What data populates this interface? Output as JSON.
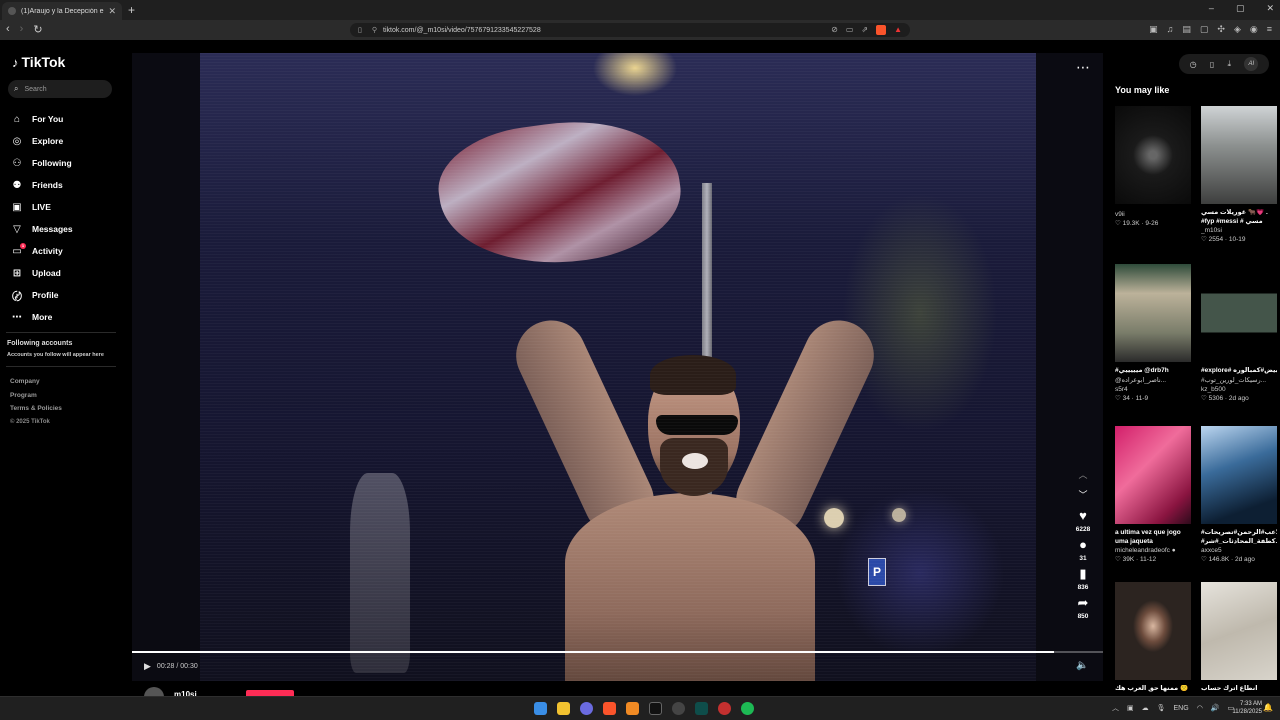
{
  "browser": {
    "tab_title": "(1)Araujo y la Decepción en la C...",
    "url": "tiktok.com/@_m10si/video/7576791233545227528",
    "new_tab": "+",
    "win_min": "–",
    "win_max": "▢",
    "win_close": "✕"
  },
  "sidebar": {
    "logo_text": "TikTok",
    "search_placeholder": "Search",
    "items": [
      {
        "label": "For You",
        "icon": "home-icon",
        "glyph": "⌂"
      },
      {
        "label": "Explore",
        "icon": "compass-icon",
        "glyph": "◎"
      },
      {
        "label": "Following",
        "icon": "following-icon",
        "glyph": "⚇"
      },
      {
        "label": "Friends",
        "icon": "friends-icon",
        "glyph": "⚉"
      },
      {
        "label": "LIVE",
        "icon": "live-icon",
        "glyph": "▣"
      },
      {
        "label": "Messages",
        "icon": "messages-icon",
        "glyph": "▽"
      },
      {
        "label": "Activity",
        "icon": "activity-icon",
        "glyph": "▭",
        "badge": "1"
      },
      {
        "label": "Upload",
        "icon": "upload-icon",
        "glyph": "⊞"
      },
      {
        "label": "Profile",
        "icon": "profile-icon",
        "glyph": "〄"
      },
      {
        "label": "More",
        "icon": "more-icon",
        "glyph": "⋯"
      }
    ],
    "following_title": "Following accounts",
    "following_sub": "Accounts you follow will appear here",
    "footer": [
      "Company",
      "Program",
      "Terms & Policies"
    ],
    "copyright": "© 2025 TikTok"
  },
  "video": {
    "time": "00:28 / 00:30",
    "progress": 0.95,
    "likes": "6228",
    "comments": "31",
    "saves": "836",
    "shares": "850",
    "author": "m10si"
  },
  "right_panel": {
    "title": "You may like",
    "recs": [
      {
        "caption": "",
        "user": "v9ii",
        "meta": "♡ 19.3K · 9-26"
      },
      {
        "caption": "#fyp #messi # مسي",
        "user": "_m10si",
        "meta": "♡ 2554 · 10-19",
        "caption_top": "غوريلات مسي 🐂💗 ."
      },
      {
        "caption": "#ميييييي @drb7h",
        "user": "s5r4",
        "meta": "♡ 34 · 11-9",
        "caption2": "@ناصر_ابوعراده..."
      },
      {
        "caption": "#explore# ابيض#كمبالوره",
        "user": "kz_b500",
        "meta": "♡ 5306 · 2d ago",
        "caption2": "#رسيكات_لورين_توب..."
      },
      {
        "caption": "a ultima vez que jogo",
        "caption2": "uma jaqueta",
        "user": "micheleandradeofc ●",
        "meta": "♡ 39K · 11-12"
      },
      {
        "caption": "#الاعب#الرحمن#تصريحات",
        "caption2": "#كطفة_المحادثات_#شر...",
        "user": "axxce5",
        "meta": "♡ 146.8K · 2d ago"
      },
      {
        "caption": "ممنها حق العرب هك 🙁",
        "user": "",
        "meta": ""
      },
      {
        "caption": "انطاع اترك حساب",
        "user": "",
        "meta": ""
      }
    ]
  },
  "taskbar": {
    "lang": "ENG",
    "time": "7:33 AM",
    "date": "11/28/2025"
  }
}
